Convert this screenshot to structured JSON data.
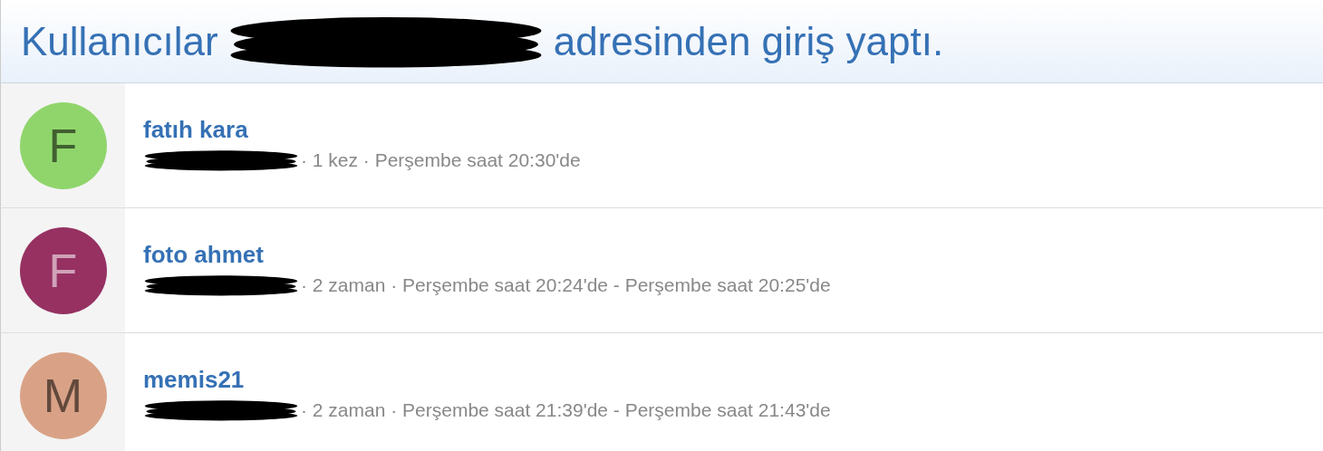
{
  "header": {
    "title_start": "Kullanıcılar",
    "title_end": "adresinden giriş yaptı."
  },
  "users": [
    {
      "initial": "F",
      "color": "#90d56c",
      "name": "fatıh kara",
      "detail": "· 1 kez · Perşembe saat 20:30'de"
    },
    {
      "initial": "F",
      "color": "#963162",
      "name": "foto ahmet",
      "detail": "· 2 zaman · Perşembe saat 20:24'de - Perşembe saat 20:25'de"
    },
    {
      "initial": "M",
      "color": "#d9a286",
      "name": "memis21",
      "detail": "· 2 zaman · Perşembe saat 21:39'de - Perşembe saat 21:43'de"
    }
  ]
}
